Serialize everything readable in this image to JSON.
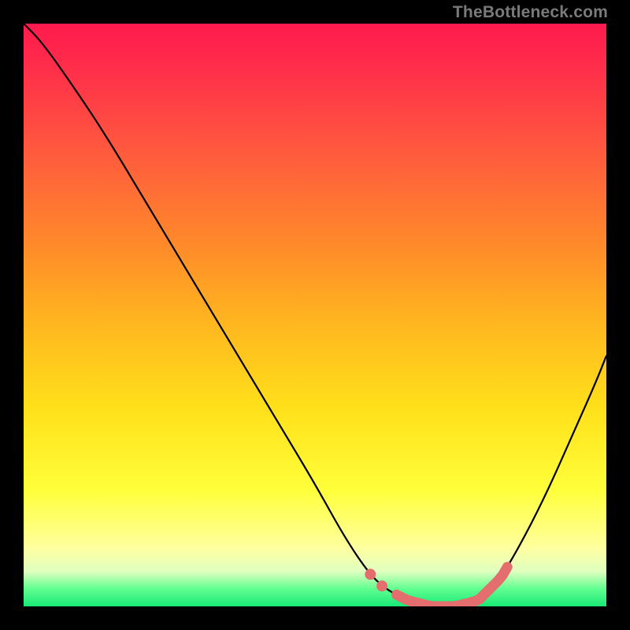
{
  "attribution": "TheBottleneck.com",
  "colors": {
    "background": "#000000",
    "curve_stroke": "#000000",
    "highlight_stroke": "#e46e6e",
    "gradient_top": "#ff1a4d",
    "gradient_mid": "#ffe01a",
    "gradient_bottom": "#18e876"
  },
  "chart_data": {
    "type": "line",
    "title": "",
    "xlabel": "",
    "ylabel": "",
    "xlim": [
      0,
      100
    ],
    "ylim": [
      0,
      100
    ],
    "series": [
      {
        "name": "bottleneck-curve",
        "x": [
          0,
          3,
          8,
          14,
          20,
          26,
          32,
          38,
          44,
          50,
          55,
          59,
          62,
          66,
          70,
          74,
          78,
          82,
          86,
          90,
          94,
          98,
          100
        ],
        "values": [
          100,
          97,
          90,
          81,
          71,
          61,
          51,
          41,
          31,
          21,
          12,
          6,
          3,
          1,
          0,
          0,
          1,
          5,
          12,
          20,
          29,
          38,
          43
        ]
      }
    ],
    "annotations": [
      {
        "name": "optimal-range-highlight",
        "x_start": 59,
        "x_end": 83,
        "comment": "Salmon highlight along the bottom of the curve (optimal zone)"
      }
    ]
  }
}
